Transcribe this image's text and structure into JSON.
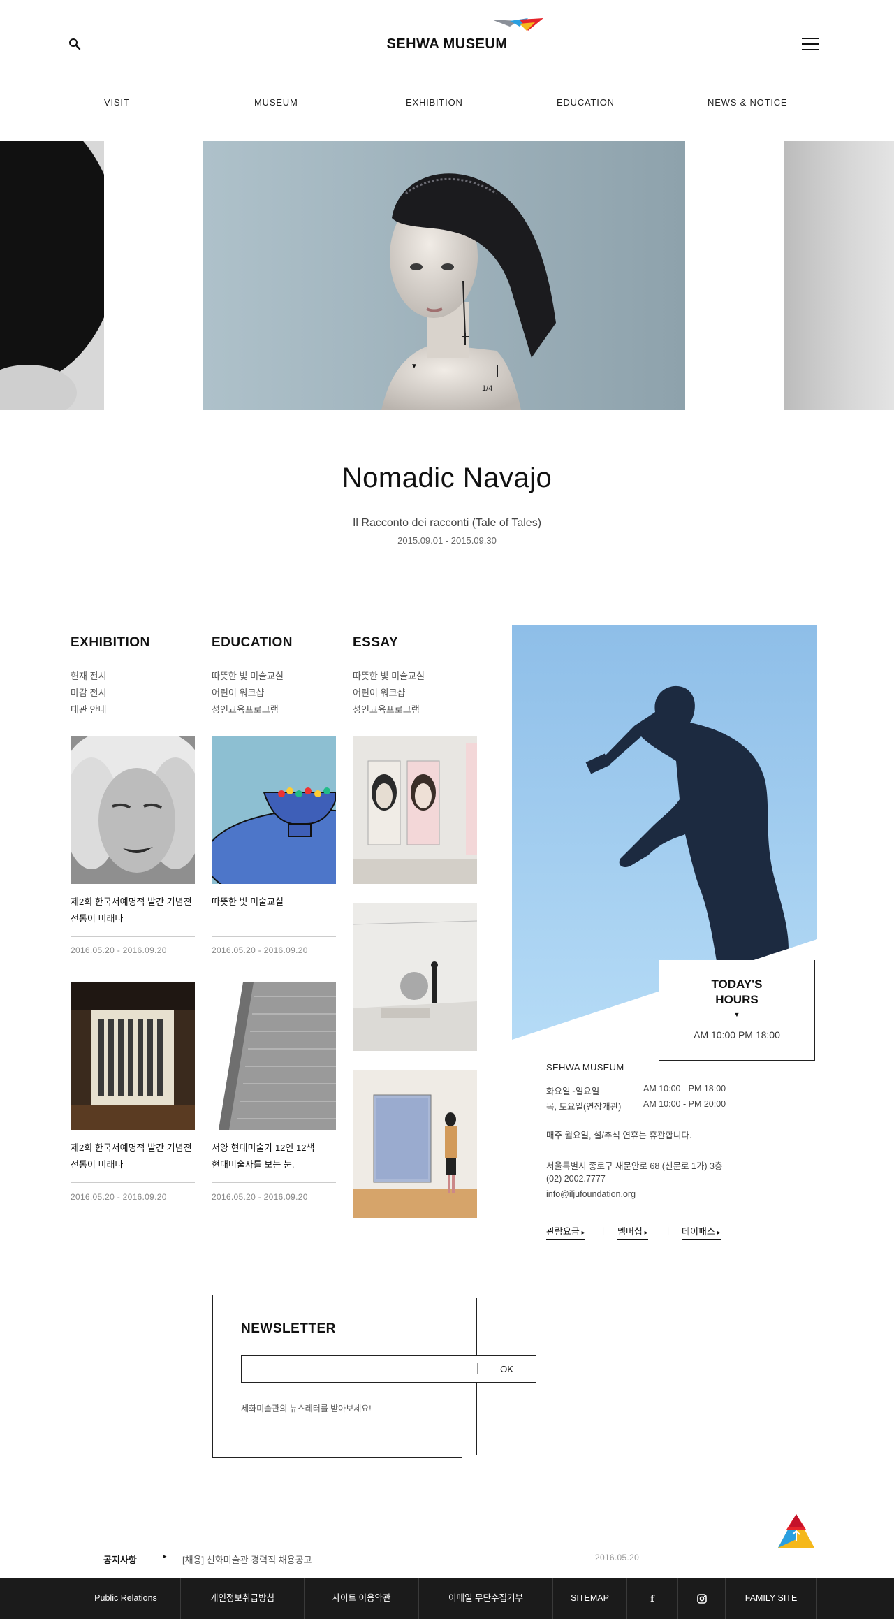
{
  "header": {
    "logo_text": "SEHWA MUSEUM",
    "nav": [
      "VISIT",
      "MUSEUM",
      "EXHIBITION",
      "EDUCATION",
      "NEWS & NOTICE"
    ]
  },
  "hero": {
    "page_indicator": "1/4",
    "title": "Nomadic Navajo",
    "subtitle": "Il Racconto dei racconti (Tale of Tales)",
    "date": "2015.09.01 - 2015.09.30"
  },
  "columns": [
    {
      "title": "EXHIBITION",
      "links": [
        "현재 전시",
        "마감 전시",
        "대관 안내"
      ],
      "cards": [
        {
          "line1": "제2회 한국서예명적 발간 기념전",
          "line2": "전통이 미래다",
          "date": "2016.05.20 - 2016.09.20"
        },
        {
          "line1": "제2회 한국서예명적 발간 기념전",
          "line2": "전통이 미래다",
          "date": "2016.05.20 - 2016.09.20"
        }
      ]
    },
    {
      "title": "EDUCATION",
      "links": [
        "따뜻한 빛 미술교실",
        "어린이 워크샵",
        "성인교육프로그램"
      ],
      "cards": [
        {
          "line1": "따뜻한 빛 미술교실",
          "line2": "",
          "date": "2016.05.20 - 2016.09.20"
        },
        {
          "line1": "서양 현대미술가 12인 12색",
          "line2": "현대미술사를 보는 눈.",
          "date": "2016.05.20 - 2016.09.20"
        }
      ]
    },
    {
      "title": "ESSAY",
      "links": [
        "따뜻한 빛 미술교실",
        "어린이 워크샵",
        "성인교육프로그램"
      ]
    }
  ],
  "hours": {
    "title_line1": "TODAY'S",
    "title_line2": "HOURS",
    "time": "AM 10:00 PM 18:00"
  },
  "info": {
    "name": "SEHWA MUSEUM",
    "rows": [
      {
        "label": "화요일~일요일",
        "value": "AM 10:00 - PM 18:00"
      },
      {
        "label": "목, 토요일(연장개관)",
        "value": "AM 10:00 - PM 20:00"
      }
    ],
    "closed": "매주 월요일, 설/추석 연휴는 휴관합니다.",
    "address": "서울특별시 종로구 새문안로 68 (신문로 1가) 3층",
    "phone": "(02) 2002.7777",
    "email": "info@iljufoundation.org",
    "quick_links": [
      "관람요금",
      "멤버십",
      "데이패스"
    ]
  },
  "newsletter": {
    "title": "NEWSLETTER",
    "input_placeholder": "",
    "ok_label": "OK",
    "note": "세화미술관의 뉴스레터를 받아보세요!"
  },
  "notice": {
    "label": "공지사항",
    "text": "[채용] 선화미술관 경력직 채용공고",
    "date": "2016.05.20"
  },
  "footer": {
    "links": [
      "Public Relations",
      "개인정보취급방침",
      "사이트 이용약관",
      "이메일 무단수집거부",
      "SITEMAP",
      "f",
      "instagram",
      "FAMILY SITE"
    ]
  },
  "colors": {
    "accent_red": "#e5242b",
    "accent_yellow": "#f5b81b",
    "accent_blue": "#2a9fe0",
    "sky": "#9ec9ee",
    "footer_bg": "#1b1b1b"
  }
}
